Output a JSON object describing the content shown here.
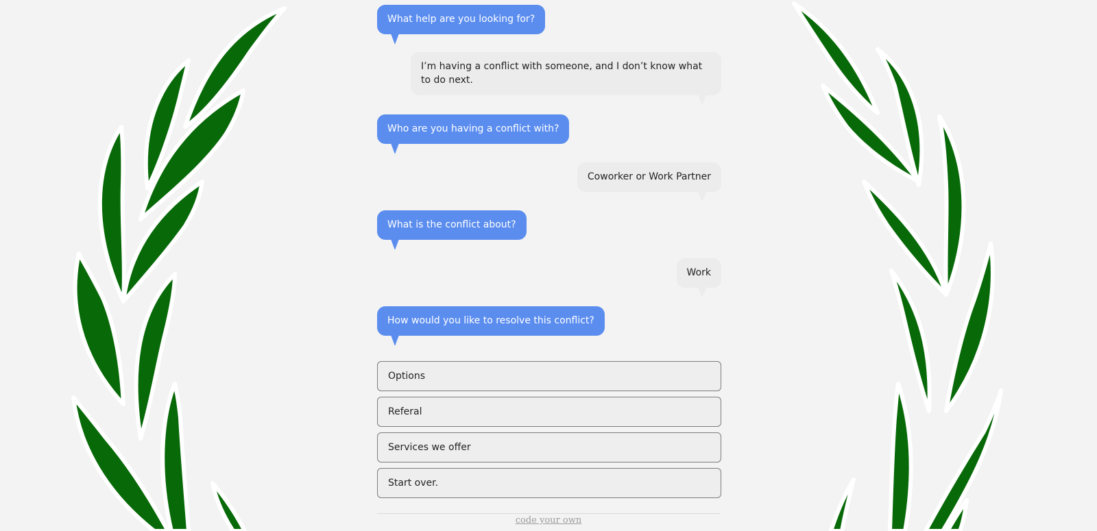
{
  "colors": {
    "background": "#f3f3f3",
    "bot_bubble": "#5b8def",
    "user_bubble": "#ececec",
    "leaf_fill": "#076907",
    "leaf_outline": "#ffffff"
  },
  "decor": {
    "left": "laurel-branch-icon",
    "right": "laurel-branch-icon"
  },
  "conversation": [
    {
      "speaker": "bot",
      "text": "What help are you looking for?"
    },
    {
      "speaker": "user",
      "text": "I’m having a conflict with someone, and I don’t know what to do next."
    },
    {
      "speaker": "bot",
      "text": "Who are you having a conflict with?"
    },
    {
      "speaker": "user",
      "text": "Coworker or Work Partner"
    },
    {
      "speaker": "bot",
      "text": "What is the conflict about?"
    },
    {
      "speaker": "user",
      "text": "Work"
    },
    {
      "speaker": "bot",
      "text": "How would you like to resolve this conflict?"
    }
  ],
  "options": [
    {
      "label": "Options"
    },
    {
      "label": "Referal"
    },
    {
      "label": "Services we offer"
    },
    {
      "label": "Start over."
    }
  ],
  "footer": {
    "link_text": "code your own"
  }
}
